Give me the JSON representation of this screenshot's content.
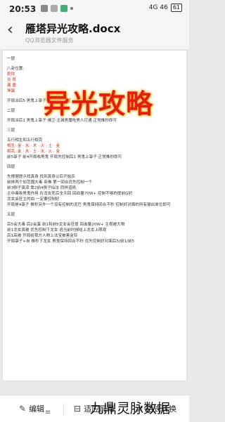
{
  "status_bar": {
    "time": "20:53",
    "signal": "4G 46",
    "battery": "61"
  },
  "header": {
    "back_icon": "chevron-left-icon",
    "title": "雁塔异光攻略.docx",
    "subtitle": "QQ浏览器文件服务"
  },
  "document": {
    "overlay_title": "异光攻略",
    "lines": [
      {
        "text": "一层",
        "cls": ""
      },
      {
        "text": "八卦位置:",
        "cls": "sec"
      },
      {
        "text": "  乾坎",
        "cls": "red"
      },
      {
        "text": "  兑    艮",
        "cls": "red"
      },
      {
        "text": "  离    震",
        "cls": "red"
      },
      {
        "text": "  坤巽",
        "cls": "red"
      },
      {
        "text": "开局派后5 男鬼上箓子  正常推秒即可",
        "cls": "sec"
      },
      {
        "text": "二层",
        "cls": "sec"
      },
      {
        "text": "开局派后1 男鬼上箓子 褐卫·主城男魔吃男人打通  正常推秒即可",
        "cls": "sec"
      },
      {
        "text": "三层",
        "cls": "sec"
      },
      {
        "text": "五行相生和五行相克",
        "cls": "sec"
      },
      {
        "text": "相生: 金 · 水 · 木 · 火 · 土 · 金",
        "cls": "red"
      },
      {
        "text": "相克: 金 · 木 · 土 · 水 · 火 · 金",
        "cls": "red"
      },
      {
        "text": "前5箓子 前4开局收男鬼  开局先控制后1 男鬼上箓子 正常推秒即可",
        "cls": ""
      },
      {
        "text": "四层",
        "cls": "sec"
      },
      {
        "text": "先根据提示找真身  找到真身以后开始杀",
        "cls": "sec"
      },
      {
        "text": "前排两个加范围大毒  亲佛  第一回合优先控制一个",
        "cls": ""
      },
      {
        "text": "前3侧子真谛  靠2前4侧子仙法  同样道術",
        "cls": ""
      },
      {
        "text": "主中毒吸男鬼作用  在龙女死后全天回  回血量70W+  控制不够的提前G好",
        "cls": ""
      },
      {
        "text": "龙女会狂主的血  一定要控制好",
        "cls": ""
      },
      {
        "text": "开局是4箓子  推秒另外一个没有控制的泥巴  男鬼保持回合不秒  控制好对面的所有输出单位即可",
        "cls": ""
      },
      {
        "text": "五层",
        "cls": "sec"
      },
      {
        "text": "后5会大毒  后2会蛋  前1和前5龙女会狂冒  回血量20W+  主视被大物",
        "cls": "sec"
      },
      {
        "text": "前1龙女真被  优先控制下龙女  逃当前时候给上龙女上限观",
        "cls": ""
      },
      {
        "text": "后1高被  开局给我方人物上法宝被害金铃",
        "cls": ""
      },
      {
        "text": "开局箓子+自 推秒下龙女  男鬼保持回合不秒  优先控制好对面后5/前1/前5",
        "cls": ""
      }
    ]
  },
  "bottom_bar": {
    "edit_label": "编辑",
    "edit_icon": "edit-icon",
    "fit_label": "适应屏幕",
    "fit_icon": "fit-screen-icon",
    "convert_label": "格式转换",
    "convert_icon": "convert-icon"
  },
  "nav": {
    "home_icon": "home-bar-icon"
  },
  "watermark": "九鼎灵脉数据"
}
